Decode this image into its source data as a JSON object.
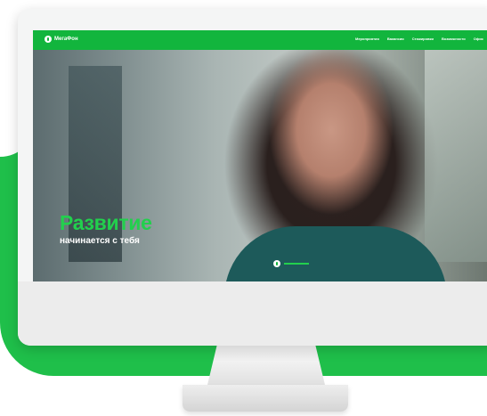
{
  "colors": {
    "brand_green": "#12b53d",
    "accent_green": "#22d04d"
  },
  "navbar": {
    "logo_text": "МегаФон",
    "links": [
      "Мероприятия",
      "Вакансии",
      "Стажировки",
      "Возможности",
      "Офис"
    ]
  },
  "hero": {
    "title": "Развитие",
    "subtitle": "начинается с тебя"
  },
  "slider": {
    "active_icon": "megafon-logo-icon"
  }
}
